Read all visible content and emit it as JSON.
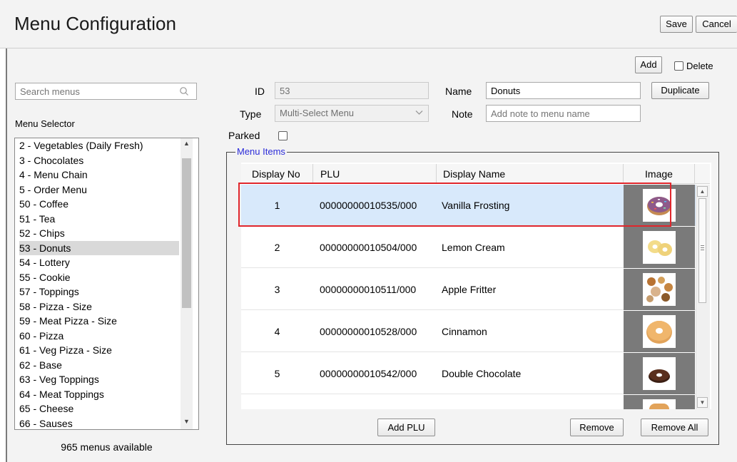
{
  "header": {
    "title": "Menu Configuration",
    "save_label": "Save",
    "cancel_label": "Cancel"
  },
  "actions": {
    "add_label": "Add",
    "delete_label": "Delete",
    "duplicate_label": "Duplicate"
  },
  "search": {
    "placeholder": "Search menus"
  },
  "menu_selector": {
    "label": "Menu Selector",
    "items": [
      "2 - Vegetables (Daily Fresh)",
      "3 - Chocolates",
      "4 - Menu Chain",
      "5 - Order Menu",
      "50 - Coffee",
      "51 - Tea",
      "52 - Chips",
      "53 - Donuts",
      "54 - Lottery",
      "55 - Cookie",
      "57 - Toppings",
      "58 - Pizza - Size",
      "59 - Meat Pizza - Size",
      "60 - Pizza",
      "61 - Veg Pizza - Size",
      "62 - Base",
      "63 - Veg Toppings",
      "64 - Meat Toppings",
      "65 - Cheese",
      "66 - Sauses"
    ],
    "selected": "53 - Donuts",
    "count_text": "965 menus available"
  },
  "form": {
    "id_label": "ID",
    "id_value": "53",
    "type_label": "Type",
    "type_value": "Multi-Select Menu",
    "name_label": "Name",
    "name_value": "Donuts",
    "note_label": "Note",
    "note_placeholder": "Add note to menu name",
    "parked_label": "Parked"
  },
  "menu_items": {
    "legend": "Menu Items",
    "columns": [
      "Display No",
      "PLU",
      "Display Name",
      "Image"
    ],
    "rows": [
      {
        "no": "1",
        "plu": "00000000010535/000",
        "name": "Vanilla Frosting",
        "image": "donut-sprinkles-image"
      },
      {
        "no": "2",
        "plu": "00000000010504/000",
        "name": "Lemon Cream",
        "image": "donut-lemon-cream-image"
      },
      {
        "no": "3",
        "plu": "00000000010511/000",
        "name": "Apple Fritter",
        "image": "donut-apple-fritter-image"
      },
      {
        "no": "4",
        "plu": "00000000010528/000",
        "name": "Cinnamon",
        "image": "donut-cinnamon-image"
      },
      {
        "no": "5",
        "plu": "00000000010542/000",
        "name": "Double Chocolate",
        "image": "donut-chocolate-image"
      }
    ],
    "selected_row": "1",
    "add_plu_label": "Add PLU",
    "remove_label": "Remove",
    "remove_all_label": "Remove All"
  },
  "colors": {
    "selection_blue": "#d8e9fb",
    "highlight_red": "#e0262c",
    "legend_blue": "#2b2bd9"
  }
}
